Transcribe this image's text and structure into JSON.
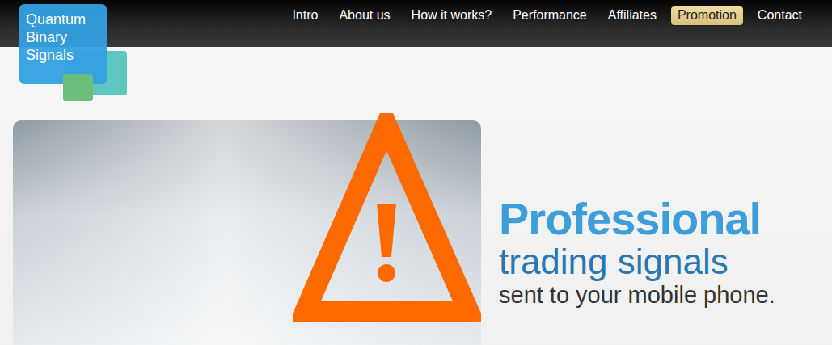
{
  "logo": {
    "text": "Quantum Binary Signals"
  },
  "nav": [
    {
      "label": "Intro",
      "selected": false
    },
    {
      "label": "About us",
      "selected": false
    },
    {
      "label": "How it works?",
      "selected": false
    },
    {
      "label": "Performance",
      "selected": false
    },
    {
      "label": "Affiliates",
      "selected": false
    },
    {
      "label": "Promotion",
      "selected": true
    },
    {
      "label": "Contact",
      "selected": false
    }
  ],
  "hero": {
    "title": "Professional",
    "subtitle": "trading signals",
    "tagline": "sent to your mobile phone."
  }
}
